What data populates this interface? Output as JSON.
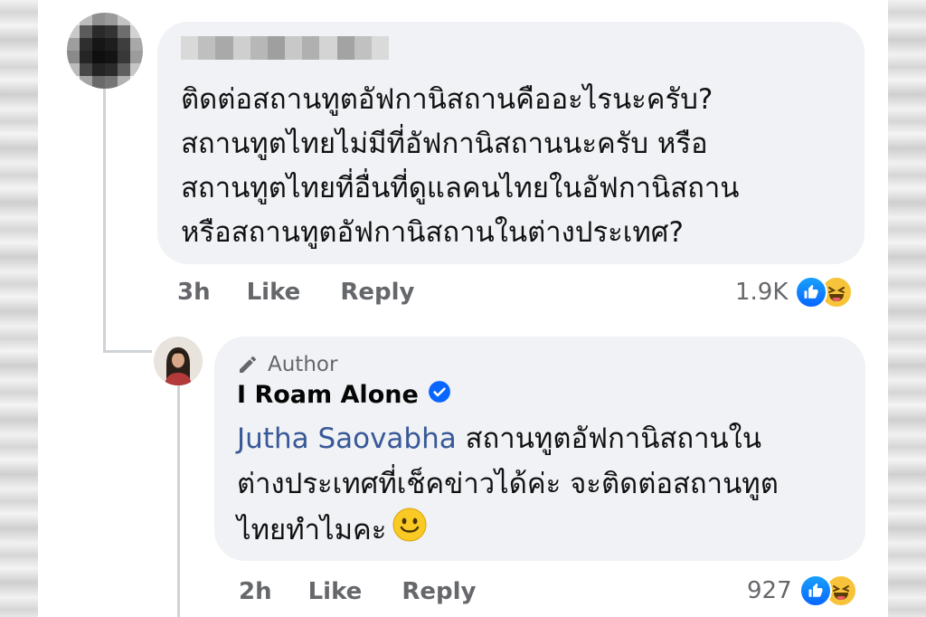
{
  "comment": {
    "text_lines": [
      "ติดต่อสถานทูตอัฟกานิสถานคืออะไรนะครับ?",
      "สถานทูตไทยไม่มีที่อัฟกานิสถานนะครับ หรือ",
      "สถานทูตไทยที่อื่นที่ดูแลคนไทยในอัฟกานิสถาน",
      "หรือสถานทูตอัฟกานิสถานในต่างประเทศ?"
    ],
    "time": "3h",
    "like_label": "Like",
    "reply_label": "Reply",
    "reaction_count": "1.9K",
    "reaction_icons": [
      "like-icon",
      "haha-icon"
    ]
  },
  "reply": {
    "badge_label": "Author",
    "author_name": "I Roam Alone",
    "mention": "Jutha Saovabha",
    "text_line1_rest": " สถานทูตอัฟกานิสถานใน",
    "text_line2": "ต่างประเทศที่เช็คข่าวได้ค่ะ จะติดต่อสถานทูต",
    "text_line3": "ไทยทำไมคะ",
    "emoji_icon": "slightly-smiling-face-icon",
    "time": "2h",
    "like_label": "Like",
    "reply_label": "Reply",
    "reaction_count": "927",
    "reaction_icons": [
      "like-icon",
      "haha-icon"
    ]
  },
  "colors": {
    "bubble": "#f0f2f5",
    "meta_text": "#65676b",
    "mention": "#385898",
    "like_blue": "#0866ff",
    "verified_blue": "#0866ff"
  }
}
